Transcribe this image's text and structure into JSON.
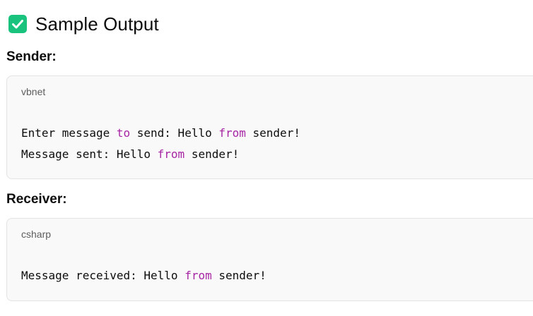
{
  "heading": {
    "icon": "check-box-icon",
    "icon_color": "#19c37d",
    "title": "Sample Output"
  },
  "sections": [
    {
      "label": "Sender:",
      "language": "vbnet",
      "lines": [
        [
          "Enter message ",
          "to",
          " send: Hello ",
          "from",
          " sender!"
        ],
        [
          "Message sent: Hello ",
          "from",
          " sender!"
        ]
      ]
    },
    {
      "label": "Receiver:",
      "language": "csharp",
      "lines": [
        [
          "Message received: Hello ",
          "from",
          " sender!"
        ]
      ]
    }
  ],
  "colors": {
    "keyword": "#a626a4",
    "code_background": "#f9f9f9",
    "code_border": "#e3e3e3"
  }
}
